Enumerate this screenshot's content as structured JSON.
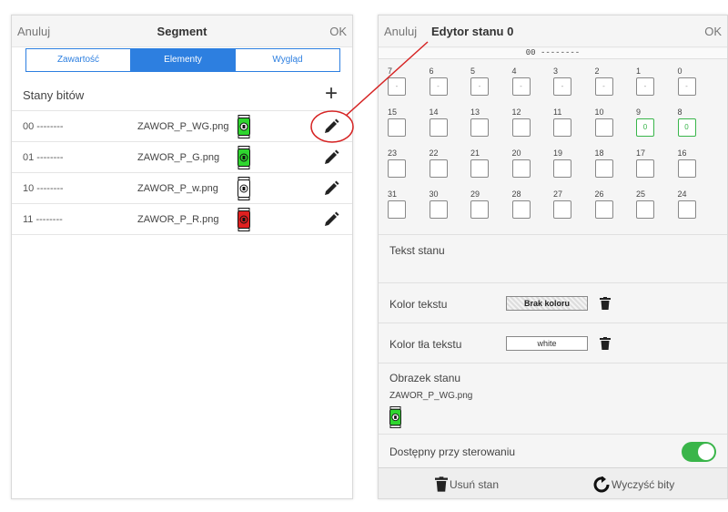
{
  "left": {
    "cancel": "Anuluj",
    "title": "Segment",
    "ok": "OK",
    "tabs": [
      {
        "label": "Zawartość",
        "active": false
      },
      {
        "label": "Elementy",
        "active": true
      },
      {
        "label": "Wygląd",
        "active": false
      }
    ],
    "states_label": "Stany bitów",
    "add_symbol": "+",
    "rows": [
      {
        "bits": "00 --------",
        "file": "ZAWOR_P_WG.png",
        "valve_color": "#2fd62f",
        "valve_accent": "#ffffff"
      },
      {
        "bits": "01 --------",
        "file": "ZAWOR_P_G.png",
        "valve_color": "#2fd62f",
        "valve_accent": "#2fd62f"
      },
      {
        "bits": "10 --------",
        "file": "ZAWOR_P_w.png",
        "valve_color": "#ffffff",
        "valve_accent": "#ffffff"
      },
      {
        "bits": "11 --------",
        "file": "ZAWOR_P_R.png",
        "valve_color": "#e02020",
        "valve_accent": "#e02020"
      }
    ]
  },
  "right": {
    "cancel": "Anuluj",
    "title": "Edytor stanu 0",
    "ok": "OK",
    "bit_pattern": "00 --------",
    "bits": [
      {
        "n": "7",
        "v": "-",
        "set": false
      },
      {
        "n": "6",
        "v": "-",
        "set": false
      },
      {
        "n": "5",
        "v": "-",
        "set": false
      },
      {
        "n": "4",
        "v": "-",
        "set": false
      },
      {
        "n": "3",
        "v": "-",
        "set": false
      },
      {
        "n": "2",
        "v": "-",
        "set": false
      },
      {
        "n": "1",
        "v": "-",
        "set": false
      },
      {
        "n": "0",
        "v": "-",
        "set": false
      },
      {
        "n": "15",
        "v": "",
        "set": false
      },
      {
        "n": "14",
        "v": "",
        "set": false
      },
      {
        "n": "13",
        "v": "",
        "set": false
      },
      {
        "n": "12",
        "v": "",
        "set": false
      },
      {
        "n": "11",
        "v": "",
        "set": false
      },
      {
        "n": "10",
        "v": "",
        "set": false
      },
      {
        "n": "9",
        "v": "0",
        "set": true
      },
      {
        "n": "8",
        "v": "0",
        "set": true
      },
      {
        "n": "23",
        "v": "",
        "set": false
      },
      {
        "n": "22",
        "v": "",
        "set": false
      },
      {
        "n": "21",
        "v": "",
        "set": false
      },
      {
        "n": "20",
        "v": "",
        "set": false
      },
      {
        "n": "19",
        "v": "",
        "set": false
      },
      {
        "n": "18",
        "v": "",
        "set": false
      },
      {
        "n": "17",
        "v": "",
        "set": false
      },
      {
        "n": "16",
        "v": "",
        "set": false
      },
      {
        "n": "31",
        "v": "",
        "set": false
      },
      {
        "n": "30",
        "v": "",
        "set": false
      },
      {
        "n": "29",
        "v": "",
        "set": false
      },
      {
        "n": "28",
        "v": "",
        "set": false
      },
      {
        "n": "27",
        "v": "",
        "set": false
      },
      {
        "n": "26",
        "v": "",
        "set": false
      },
      {
        "n": "25",
        "v": "",
        "set": false
      },
      {
        "n": "24",
        "v": "",
        "set": false
      }
    ],
    "state_text_label": "Tekst stanu",
    "text_color_label": "Kolor tekstu",
    "text_color_value": "Brak koloru",
    "bg_color_label": "Kolor tła tekstu",
    "bg_color_value": "white",
    "image_label": "Obrazek stanu",
    "image_file": "ZAWOR_P_WG.png",
    "available_label": "Dostępny przy sterowaniu",
    "available_on": true,
    "delete_state": "Usuń stan",
    "clear_bits": "Wyczyść bity"
  },
  "colors": {
    "accent": "#2d7fe0",
    "toggle_on": "#3ab54a",
    "callout": "#d62424"
  }
}
